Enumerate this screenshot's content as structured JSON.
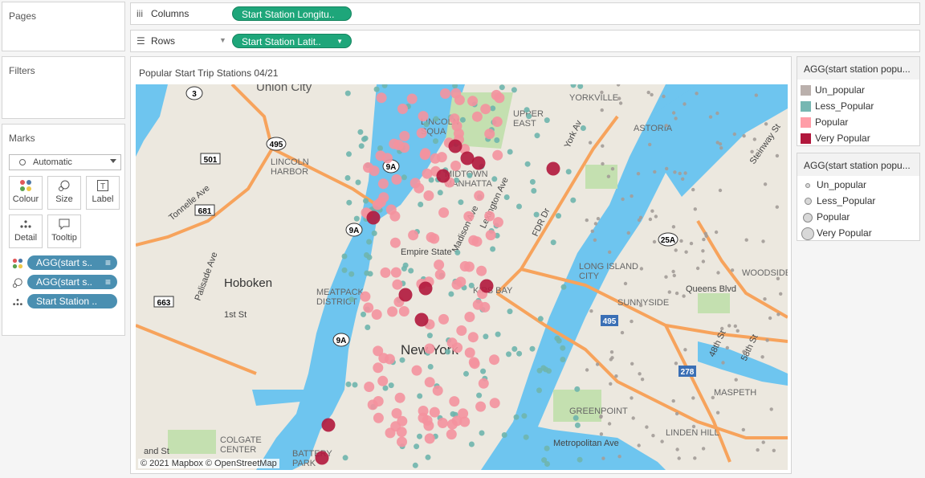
{
  "pages_label": "Pages",
  "filters_label": "Filters",
  "marks": {
    "title": "Marks",
    "type_value": "Automatic",
    "buttons": {
      "colour": "Colour",
      "size": "Size",
      "label": "Label",
      "detail": "Detail",
      "tooltip": "Tooltip"
    },
    "pills": [
      "AGG(start s..",
      "AGG(start s..",
      "Start Station .."
    ]
  },
  "shelves": {
    "columns_label": "Columns",
    "columns_pill": "Start Station Longitu..",
    "rows_label": "Rows",
    "rows_pill": "Start Station Latit.."
  },
  "viz_title": "Popular Start Trip Stations 04/21",
  "attribution": "© 2021 Mapbox © OpenStreetMap",
  "map_labels": {
    "union_city": "Union City",
    "lincoln_harbor": "LINCOLN\nHARBOR",
    "hoboken": "Hoboken",
    "meatpacking": "MEATPACK\nDISTRICT",
    "new_york": "New York",
    "astoria": "ASTORIA",
    "long_island_city": "LONG ISLAND\nCITY",
    "sunnyside": "SUNNYSIDE",
    "woodside": "WOODSIDE",
    "queens_blvd": "Queens Blvd",
    "greenpoint": "GREENPOINT",
    "maspeth": "MASPETH",
    "linden_hill": "LINDEN HILL",
    "colgate_center": "COLGATE\nCENTER",
    "battery_park": "BATTERY\nPARK",
    "tonnelle_ave": "Tonnelle Ave",
    "palisade_ave": "Palisade Ave",
    "first_st": "1st St",
    "grand_st": "and St",
    "metropolitan_ave": "Metropolitan Ave",
    "fdr": "FDR Dr",
    "york_ave": "York Av",
    "madison_ave": "Madison Ave",
    "lexington_ave": "Lexington Ave",
    "empire_state": "Empire State",
    "steinway": "Steinway St",
    "48th": "48th St",
    "58th": "58th St",
    "yorkville": "YORKVILLE",
    "upper_east": "UPPER\nEAST",
    "lincoln_square": "LINCOLN\nSQUA",
    "midtown": "MIDTOWN\nMANHATTA",
    "kips_bay": "KIPS BAY",
    "ny_3": "3",
    "ny_495": "495",
    "ny_501": "501",
    "ny_681": "681",
    "ny_663": "663",
    "ny_9a_1": "9A",
    "ny_9a_2": "9A",
    "ny_9a_3": "9A",
    "ny_25a": "25A",
    "ny_278": "278",
    "ny_495b": "495"
  },
  "colour_legend": {
    "title": "AGG(start station popu...",
    "items": [
      {
        "label": "Un_popular",
        "color": "#bab0ac"
      },
      {
        "label": "Less_Popular",
        "color": "#76b7b2"
      },
      {
        "label": "Popular",
        "color": "#ff9da7"
      },
      {
        "label": "Very Popular",
        "color": "#b1173c"
      }
    ]
  },
  "size_legend": {
    "title": "AGG(start station popu...",
    "items": [
      "Un_popular",
      "Less_Popular",
      "Popular",
      "Very Popular"
    ]
  },
  "colors": {
    "very_popular": "#b1173c",
    "popular": "#f4929f",
    "less_popular": "#6fb5ad",
    "un_popular": "#a39c98",
    "water": "#6ec5ef",
    "land": "#ece8df",
    "park": "#c4e0b0",
    "highway": "#f7a35c"
  }
}
